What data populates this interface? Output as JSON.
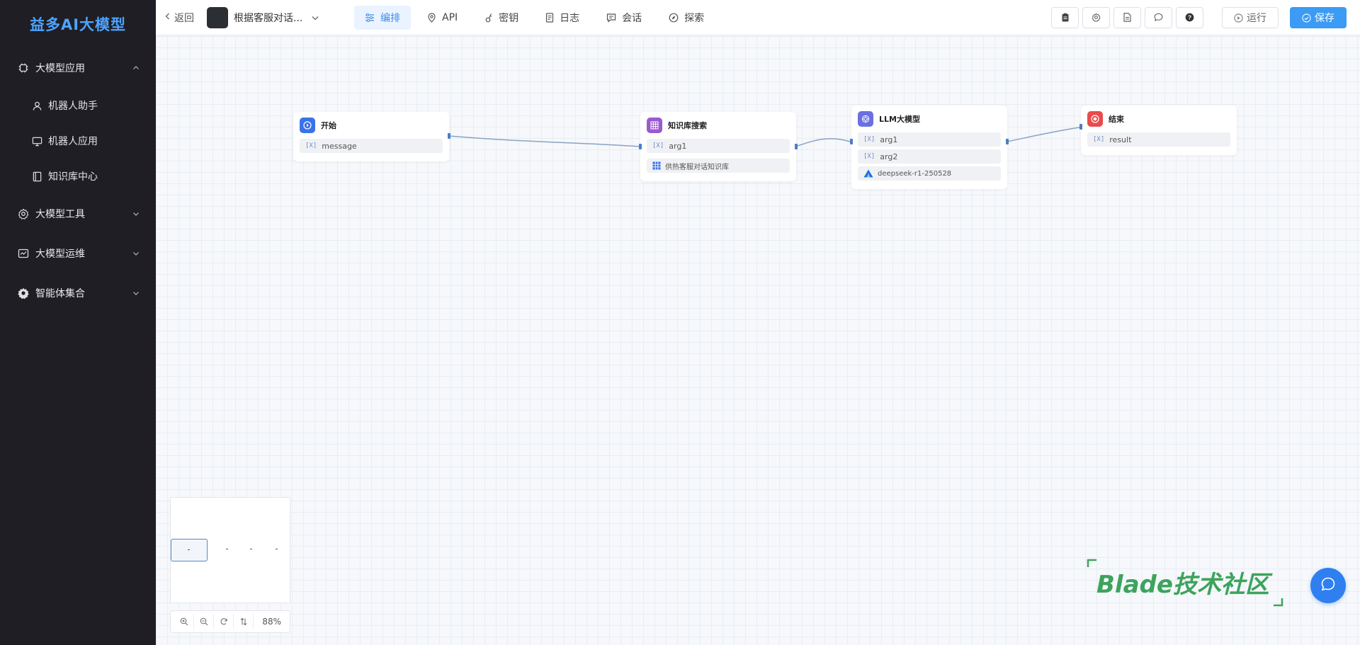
{
  "brand": "益多AI大模型",
  "sidebar": {
    "groups": [
      {
        "label": "大模型应用",
        "icon": "chip-icon",
        "expanded": true
      },
      {
        "label": "大模型工具",
        "icon": "settings-icon",
        "expanded": false
      },
      {
        "label": "大模型运维",
        "icon": "ops-icon",
        "expanded": false
      },
      {
        "label": "智能体集合",
        "icon": "gear-icon",
        "expanded": false
      }
    ],
    "subitems": [
      {
        "label": "机器人助手",
        "icon": "user-icon"
      },
      {
        "label": "机器人应用",
        "icon": "monitor-icon"
      },
      {
        "label": "知识库中心",
        "icon": "book-icon"
      }
    ]
  },
  "topbar": {
    "back_label": "返回",
    "app_name": "根据客服对话...",
    "tabs": [
      {
        "label": "编排",
        "icon": "sliders-icon",
        "active": true
      },
      {
        "label": "API",
        "icon": "pin-icon",
        "active": false
      },
      {
        "label": "密钥",
        "icon": "key-icon",
        "active": false
      },
      {
        "label": "日志",
        "icon": "log-icon",
        "active": false
      },
      {
        "label": "会话",
        "icon": "chat-icon",
        "active": false
      },
      {
        "label": "探索",
        "icon": "compass-icon",
        "active": false
      }
    ],
    "tool_buttons": [
      "clipboard-icon",
      "settings-icon",
      "document-icon",
      "message-icon",
      "help-icon"
    ],
    "run_label": "运行",
    "save_label": "保存",
    "accent": "#3b9bf5"
  },
  "nodes": {
    "start": {
      "title": "开始",
      "fields": [
        "message"
      ],
      "color": "#3a73e8"
    },
    "kb": {
      "title": "知识库搜索",
      "fields": [
        "arg1"
      ],
      "kb_name": "供热客服对话知识库",
      "color": "#9b59d0"
    },
    "llm": {
      "title": "LLM大模型",
      "fields": [
        "arg1",
        "arg2"
      ],
      "model": "deepseek-r1-250528",
      "color": "#6b6fe0"
    },
    "end": {
      "title": "结束",
      "fields": [
        "result"
      ],
      "color": "#e94b4b"
    }
  },
  "zoom": "88%",
  "watermark": "Blade技术社区"
}
